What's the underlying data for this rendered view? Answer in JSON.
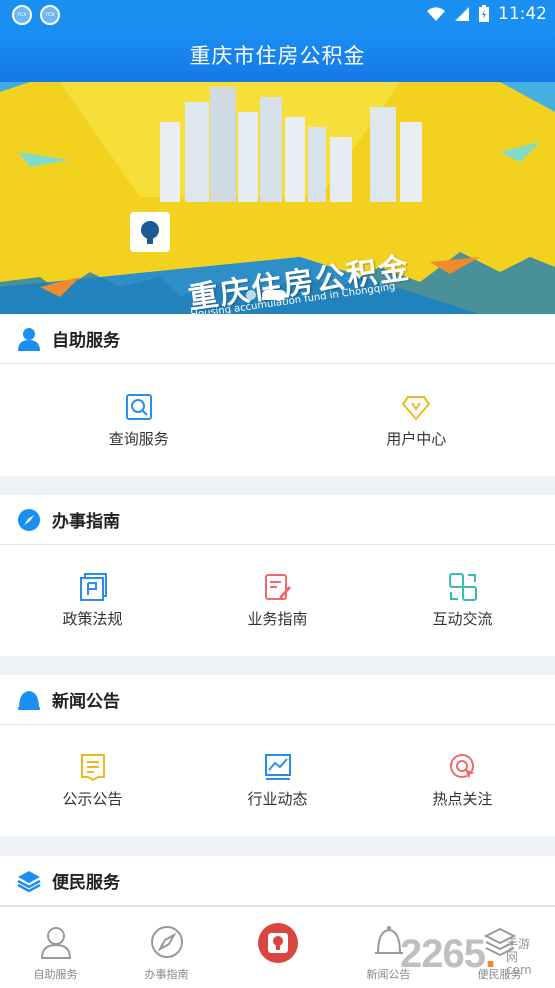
{
  "status_bar": {
    "time": "11:42",
    "app_icon_text": "rcx"
  },
  "header": {
    "title": "重庆市住房公积金"
  },
  "banner": {
    "title": "重庆住房公积金",
    "subtitle": "Housing accumulation fund in Chongqing",
    "active_slide": 2,
    "slide_count": 2
  },
  "sections": {
    "self_service": {
      "title": "自助服务",
      "icon": "person-icon",
      "items": [
        {
          "label": "查询服务",
          "icon": "search-icon",
          "color": "#2a8ee8"
        },
        {
          "label": "用户中心",
          "icon": "diamond-icon",
          "color": "#f0b81e"
        }
      ]
    },
    "guide": {
      "title": "办事指南",
      "icon": "compass-icon",
      "items": [
        {
          "label": "政策法规",
          "icon": "document-flag-icon",
          "color": "#2a8ee8"
        },
        {
          "label": "业务指南",
          "icon": "edit-document-icon",
          "color": "#f06a6a"
        },
        {
          "label": "互动交流",
          "icon": "chat-exchange-icon",
          "color": "#36bdb0"
        }
      ]
    },
    "news": {
      "title": "新闻公告",
      "icon": "bell-icon",
      "items": [
        {
          "label": "公示公告",
          "icon": "notice-icon",
          "color": "#f0b81e"
        },
        {
          "label": "行业动态",
          "icon": "trend-chart-icon",
          "color": "#2a8ee8"
        },
        {
          "label": "热点关注",
          "icon": "hotspot-icon",
          "color": "#f06a6a"
        }
      ]
    },
    "convenience": {
      "title": "便民服务",
      "icon": "layers-icon"
    }
  },
  "bottom_nav": [
    {
      "label": "自助服务",
      "icon": "person-icon"
    },
    {
      "label": "办事指南",
      "icon": "compass-icon"
    },
    {
      "label": "",
      "icon": "home-logo-icon"
    },
    {
      "label": "新闻公告",
      "icon": "bell-icon"
    },
    {
      "label": "便民服务",
      "icon": "layers-icon"
    }
  ],
  "watermark": {
    "number": "2265",
    "dot": ".",
    "text_line1": "手游网",
    "text_line2": "com"
  },
  "colors": {
    "primary": "#1a8ff2",
    "accent_red": "#d9453f"
  }
}
